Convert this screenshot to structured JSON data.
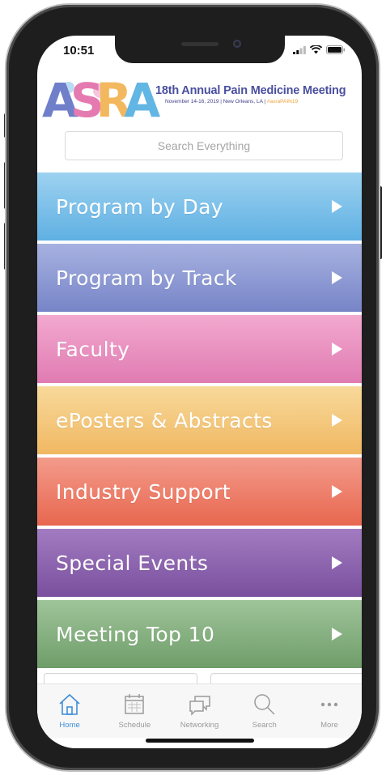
{
  "status": {
    "time": "10:51"
  },
  "header": {
    "logo_text": "ASRA",
    "title": "18th Annual Pain Medicine Meeting",
    "subtitle": "November 14-16, 2019 | New Orleans, LA |",
    "subtitle_tag": "#asraPAIN19"
  },
  "search": {
    "placeholder": "Search Everything"
  },
  "menu": {
    "items": [
      {
        "label": "Program by Day",
        "color_top": "#9dd2f0",
        "color_bottom": "#5fb0e3"
      },
      {
        "label": "Program by Track",
        "color_top": "#a7b1e0",
        "color_bottom": "#7785c8"
      },
      {
        "label": "Faculty",
        "color_top": "#f2a9cf",
        "color_bottom": "#e07bb2"
      },
      {
        "label": "ePosters & Abstracts",
        "color_top": "#f8d99b",
        "color_bottom": "#f0b862"
      },
      {
        "label": "Industry Support",
        "color_top": "#f39b8b",
        "color_bottom": "#e8674f"
      },
      {
        "label": "Special Events",
        "color_top": "#a27cc2",
        "color_bottom": "#7a4f9d"
      },
      {
        "label": "Meeting Top 10",
        "color_top": "#9fc49a",
        "color_bottom": "#6f9d69"
      }
    ]
  },
  "tabbar": {
    "tabs": [
      {
        "label": "Home",
        "icon": "home-icon",
        "active": true
      },
      {
        "label": "Schedule",
        "icon": "calendar-icon",
        "active": false
      },
      {
        "label": "Networking",
        "icon": "chat-icon",
        "active": false
      },
      {
        "label": "Search",
        "icon": "search-icon",
        "active": false
      },
      {
        "label": "More",
        "icon": "more-icon",
        "active": false
      }
    ],
    "active_color": "#3e8ed6",
    "inactive_color": "#9a9a9a"
  }
}
